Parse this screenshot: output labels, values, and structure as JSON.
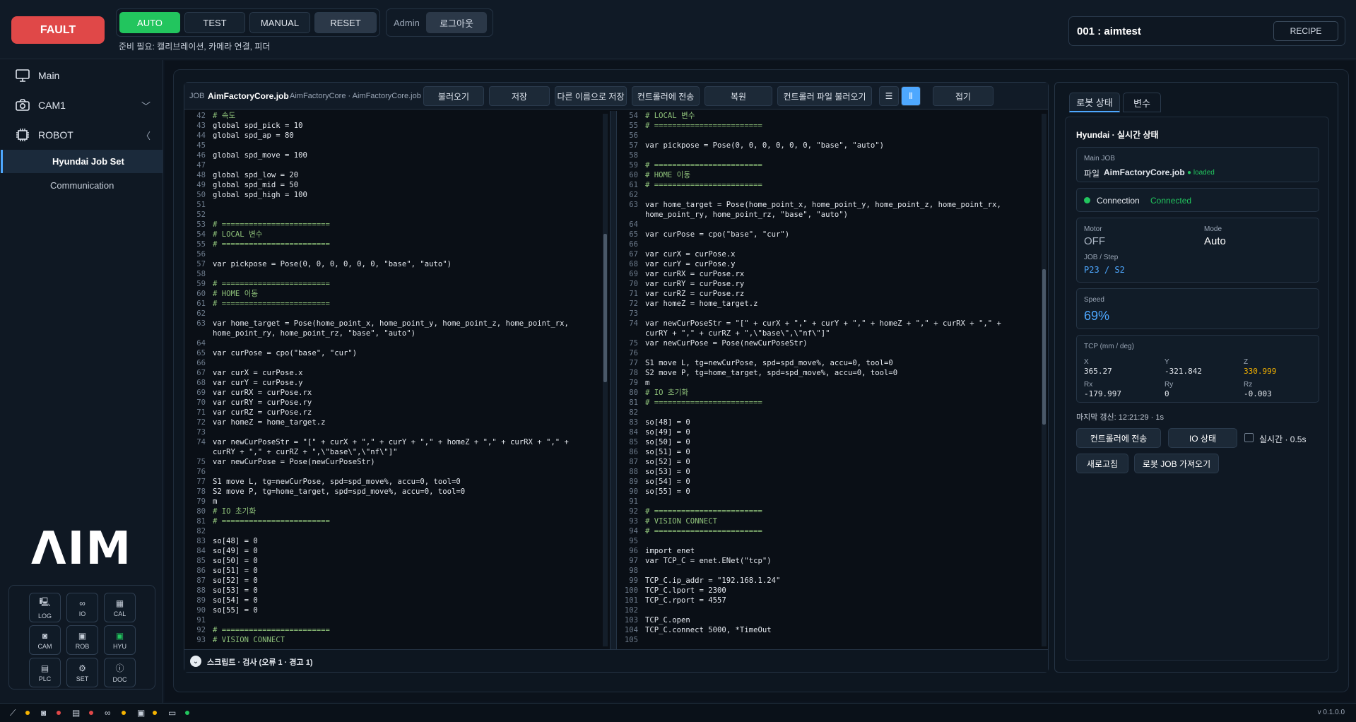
{
  "header": {
    "fault": "FAULT",
    "modes": [
      "AUTO",
      "TEST",
      "MANUAL",
      "RESET"
    ],
    "ready": "준비 필요: 캘리브레이션, 카메라 연결, 피더",
    "admin": "Admin",
    "logout": "로그아웃",
    "recipe_name": "001 : aimtest",
    "recipe_button": "RECIPE"
  },
  "sidebar": {
    "main": "Main",
    "cam1": "CAM1",
    "robot": "ROBOT",
    "sub_job": "Hyundai Job Set",
    "sub_comm": "Communication",
    "logo": "ΛIM",
    "tiles": [
      {
        "icon": "log-icon",
        "label": "LOG"
      },
      {
        "icon": "io-icon",
        "label": "IO"
      },
      {
        "icon": "cal-icon",
        "label": "CAL"
      },
      {
        "icon": "cam-icon",
        "label": "CAM"
      },
      {
        "icon": "rob-icon",
        "label": "ROB"
      },
      {
        "icon": "hyu-icon",
        "label": "HYU"
      },
      {
        "icon": "plc-icon",
        "label": "PLC"
      },
      {
        "icon": "set-icon",
        "label": "SET"
      },
      {
        "icon": "doc-icon",
        "label": "DOC"
      }
    ]
  },
  "editor": {
    "job_label": "JOB",
    "job_name": "AimFactoryCore.job",
    "job_path": "AimFactoryCore · AimFactoryCore.job",
    "buttons": [
      "불러오기",
      "저장",
      "다른 이름으로 저장",
      "컨트롤러에 전송",
      "복원",
      "컨트롤러 파일 불러오기"
    ],
    "fold": "접기",
    "bottom": "스크립트 · 검사 (오류 1 · 경고 1)",
    "left_lines": [
      [
        "42",
        "# 속도"
      ],
      [
        "43",
        "global spd_pick = 10"
      ],
      [
        "44",
        "global spd_ap = 80"
      ],
      [
        "45",
        ""
      ],
      [
        "46",
        "global spd_move = 100"
      ],
      [
        "47",
        ""
      ],
      [
        "48",
        "global spd_low = 20"
      ],
      [
        "49",
        "global spd_mid = 50"
      ],
      [
        "50",
        "global spd_high = 100"
      ],
      [
        "51",
        ""
      ],
      [
        "52",
        ""
      ],
      [
        "53",
        "# ========================"
      ],
      [
        "54",
        "# LOCAL 변수"
      ],
      [
        "55",
        "# ========================"
      ],
      [
        "56",
        ""
      ],
      [
        "57",
        "var pickpose = Pose(0, 0, 0, 0, 0, 0, \"base\", \"auto\")"
      ],
      [
        "58",
        ""
      ],
      [
        "59",
        "# ========================"
      ],
      [
        "60",
        "# HOME 이동"
      ],
      [
        "61",
        "# ========================"
      ],
      [
        "62",
        ""
      ],
      [
        "63",
        "var home_target = Pose(home_point_x, home_point_y, home_point_z, home_point_rx,\nhome_point_ry, home_point_rz, \"base\", \"auto\")"
      ],
      [
        "64",
        ""
      ],
      [
        "65",
        "var curPose = cpo(\"base\", \"cur\")"
      ],
      [
        "66",
        ""
      ],
      [
        "67",
        "var curX = curPose.x"
      ],
      [
        "68",
        "var curY = curPose.y"
      ],
      [
        "69",
        "var curRX = curPose.rx"
      ],
      [
        "70",
        "var curRY = curPose.ry"
      ],
      [
        "71",
        "var curRZ = curPose.rz"
      ],
      [
        "72",
        "var homeZ = home_target.z"
      ],
      [
        "73",
        ""
      ],
      [
        "74",
        "var newCurPoseStr = \"[\" + curX + \",\" + curY + \",\" + homeZ + \",\" + curRX + \",\" +\ncurRY + \",\" + curRZ + \",\\\"base\\\",\\\"nf\\\"]\""
      ],
      [
        "75",
        "var newCurPose = Pose(newCurPoseStr)"
      ],
      [
        "76",
        ""
      ],
      [
        "77",
        "S1 move L, tg=newCurPose, spd=spd_move%, accu=0, tool=0"
      ],
      [
        "78",
        "S2 move P, tg=home_target, spd=spd_move%, accu=0, tool=0"
      ],
      [
        "79",
        "m"
      ],
      [
        "80",
        "# IO 초기화"
      ],
      [
        "81",
        "# ========================"
      ],
      [
        "82",
        ""
      ],
      [
        "83",
        "so[48] = 0"
      ],
      [
        "84",
        "so[49] = 0"
      ],
      [
        "85",
        "so[50] = 0"
      ],
      [
        "86",
        "so[51] = 0"
      ],
      [
        "87",
        "so[52] = 0"
      ],
      [
        "88",
        "so[53] = 0"
      ],
      [
        "89",
        "so[54] = 0"
      ],
      [
        "90",
        "so[55] = 0"
      ],
      [
        "91",
        ""
      ],
      [
        "92",
        "# ========================"
      ],
      [
        "93",
        "# VISION CONNECT"
      ]
    ],
    "right_lines": [
      [
        "54",
        "# LOCAL 변수"
      ],
      [
        "55",
        "# ========================"
      ],
      [
        "56",
        ""
      ],
      [
        "57",
        "var pickpose = Pose(0, 0, 0, 0, 0, 0, \"base\", \"auto\")"
      ],
      [
        "58",
        ""
      ],
      [
        "59",
        "# ========================"
      ],
      [
        "60",
        "# HOME 이동"
      ],
      [
        "61",
        "# ========================"
      ],
      [
        "62",
        ""
      ],
      [
        "63",
        "var home_target = Pose(home_point_x, home_point_y, home_point_z, home_point_rx,\nhome_point_ry, home_point_rz, \"base\", \"auto\")"
      ],
      [
        "64",
        ""
      ],
      [
        "65",
        "var curPose = cpo(\"base\", \"cur\")"
      ],
      [
        "66",
        ""
      ],
      [
        "67",
        "var curX = curPose.x"
      ],
      [
        "68",
        "var curY = curPose.y"
      ],
      [
        "69",
        "var curRX = curPose.rx"
      ],
      [
        "70",
        "var curRY = curPose.ry"
      ],
      [
        "71",
        "var curRZ = curPose.rz"
      ],
      [
        "72",
        "var homeZ = home_target.z"
      ],
      [
        "73",
        ""
      ],
      [
        "74",
        "var newCurPoseStr = \"[\" + curX + \",\" + curY + \",\" + homeZ + \",\" + curRX + \",\" +\ncurRY + \",\" + curRZ + \",\\\"base\\\",\\\"nf\\\"]\""
      ],
      [
        "75",
        "var newCurPose = Pose(newCurPoseStr)"
      ],
      [
        "76",
        ""
      ],
      [
        "77",
        "S1 move L, tg=newCurPose, spd=spd_move%, accu=0, tool=0"
      ],
      [
        "78",
        "S2 move P, tg=home_target, spd=spd_move%, accu=0, tool=0"
      ],
      [
        "79",
        "m"
      ],
      [
        "80",
        "# IO 초기화"
      ],
      [
        "81",
        "# ========================"
      ],
      [
        "82",
        ""
      ],
      [
        "83",
        "so[48] = 0"
      ],
      [
        "84",
        "so[49] = 0"
      ],
      [
        "85",
        "so[50] = 0"
      ],
      [
        "86",
        "so[51] = 0"
      ],
      [
        "87",
        "so[52] = 0"
      ],
      [
        "88",
        "so[53] = 0"
      ],
      [
        "89",
        "so[54] = 0"
      ],
      [
        "90",
        "so[55] = 0"
      ],
      [
        "91",
        ""
      ],
      [
        "92",
        "# ========================"
      ],
      [
        "93",
        "# VISION CONNECT"
      ],
      [
        "94",
        "# ========================"
      ],
      [
        "95",
        ""
      ],
      [
        "96",
        "import enet"
      ],
      [
        "97",
        "var TCP_C = enet.ENet(\"tcp\")"
      ],
      [
        "98",
        ""
      ],
      [
        "99",
        "TCP_C.ip_addr = \"192.168.1.24\""
      ],
      [
        "100",
        "TCP_C.lport = 2300"
      ],
      [
        "101",
        "TCP_C.rport = 4557"
      ],
      [
        "102",
        ""
      ],
      [
        "103",
        "TCP_C.open"
      ],
      [
        "104",
        "TCP_C.connect 5000, *TimeOut"
      ],
      [
        "105",
        ""
      ]
    ]
  },
  "robot": {
    "tabs": [
      "로봇 상태",
      "변수"
    ],
    "title": "Hyundai · 실시간 상태",
    "main_job_label": "Main JOB",
    "file_label": "파일",
    "file_name": "AimFactoryCore.job",
    "loaded": "● loaded",
    "conn_label": "Connection",
    "conn_value": "Connected",
    "motor_label": "Motor",
    "motor_value": "OFF",
    "mode_label": "Mode",
    "mode_value": "Auto",
    "jobstep_label": "JOB / Step",
    "jobstep_value": "P23 / S2",
    "speed_label": "Speed",
    "speed_value": "69%",
    "tcp_label": "TCP (mm / deg)",
    "tcp": [
      {
        "k": "X",
        "v": "365.27"
      },
      {
        "k": "Y",
        "v": "-321.842"
      },
      {
        "k": "Z",
        "v": "330.999"
      },
      {
        "k": "Rx",
        "v": "-179.997"
      },
      {
        "k": "Ry",
        "v": "0"
      },
      {
        "k": "Rz",
        "v": "-0.003"
      }
    ],
    "last_update": "마지막 갱신: 12:21:29 · 1s",
    "send": "컨트롤러에 전송",
    "io_state": "IO 상태",
    "realtime": "실시간 · 0.5s",
    "refresh": "새로고침",
    "fetch_job": "로봇 JOB 가져오기"
  },
  "statusbar": {
    "version": "v 0.1.0.0"
  },
  "colors": {
    "accent": "#4ea8ff",
    "ok": "#22c55e",
    "fault": "#e04848",
    "warn": "#f5b301"
  }
}
